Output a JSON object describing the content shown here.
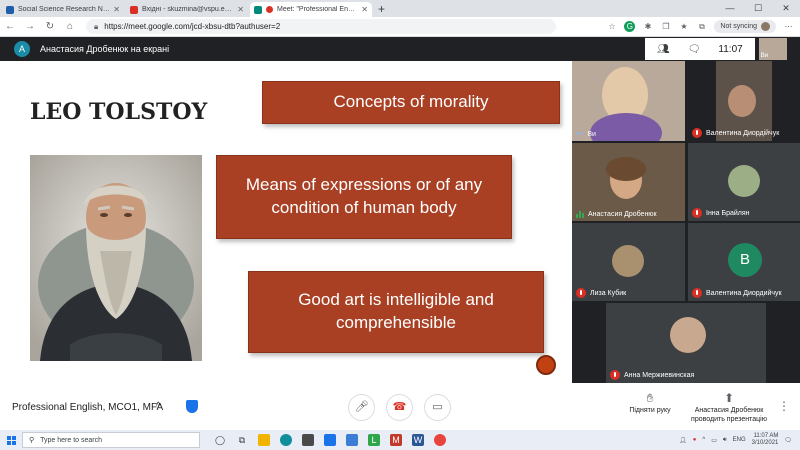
{
  "browser": {
    "tabs": [
      {
        "title": "Social Science Research Network",
        "favicon_color": "#1d5fa8",
        "active": false
      },
      {
        "title": "Вхідні - skuzmina@vspu.edu.ua",
        "favicon_color": "#d93025",
        "active": false
      },
      {
        "title": "Meet: \"Professional English",
        "favicon_color": "#00897b",
        "active": true
      }
    ],
    "new_tab_label": "+",
    "url": "https://meet.google.com/jcd-xbsu-dtb?authuser=2",
    "sync_label": "Not syncing"
  },
  "meet_header": {
    "presenter_initial": "A",
    "presenting_text": "Анастасия Дробенюк на екрані",
    "clock": "11:07",
    "self_label": "Ви"
  },
  "slide": {
    "author": "LEO TOLSTOY",
    "box1": "Concepts of morality",
    "box2": "Means of expressions or of any condition of human body",
    "box3": "Good art is intelligible and comprehensible"
  },
  "participants": [
    {
      "name": "Ви",
      "mic": "none"
    },
    {
      "name": "Валентина Диордійчук",
      "mic": "muted"
    },
    {
      "name": "Анастасия Дробенюк",
      "mic": "live"
    },
    {
      "name": "Інна Брайлян",
      "mic": "muted"
    },
    {
      "name": "Лиза Кубик",
      "mic": "muted"
    },
    {
      "name": "Валентина Диордийчук",
      "mic": "muted",
      "initial": "B"
    },
    {
      "name": "Анна Мержиевинская",
      "mic": "muted"
    }
  ],
  "bottom_bar": {
    "meeting_name": "Professional English, MCO1, MFA",
    "raise_hand_label": "Підняти руку",
    "presenting_line1": "Анастасия Дробенюк",
    "presenting_line2": "проводить презентацію"
  },
  "taskbar": {
    "search_placeholder": "Type here to search",
    "language": "ENG",
    "time": "11:07 AM",
    "date": "3/10/2021"
  }
}
